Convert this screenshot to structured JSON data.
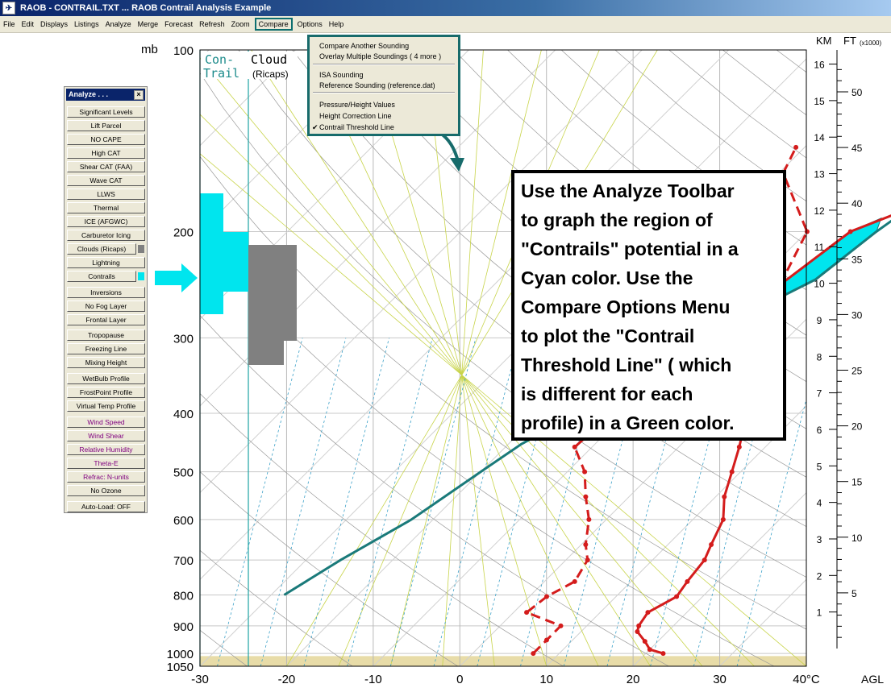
{
  "window": {
    "title": "RAOB  -  CONTRAIL.TXT  ...  RAOB Contrail Analysis Example"
  },
  "menu": [
    "File",
    "Edit",
    "Displays",
    "Listings",
    "Analyze",
    "Merge",
    "Forecast",
    "Refresh",
    "Zoom",
    "Compare",
    "Options",
    "Help"
  ],
  "menu_active": "Compare",
  "compare_menu": {
    "items": [
      "Compare Another Sounding",
      "Overlay Multiple Soundings  ( 4 more )",
      "ISA Sounding",
      "Reference Sounding (reference.dat)",
      "Pressure/Height Values",
      "Height Correction Line",
      "Contrail Threshold Line"
    ],
    "checked": "Contrail Threshold Line"
  },
  "analyze_toolbar": {
    "title": "Analyze . . .",
    "close": "×",
    "buttons": [
      "Significant Levels",
      "Lift Parcel",
      "NO CAPE",
      "High CAT",
      "Shear CAT  (FAA)",
      "Wave CAT",
      "LLWS",
      "Thermal",
      "ICE (AFGWC)",
      "Carburetor Icing",
      "Clouds (Ricaps)",
      "Lightning",
      "Contrails",
      "Inversions",
      "No Fog Layer",
      "Frontal Layer",
      "Tropopause",
      "Freezing Line",
      "Mixing Height",
      "WetBulb Profile",
      "FrostPoint Profile",
      "Virtual Temp Profile",
      "Wind Speed",
      "Wind Shear",
      "Relative Humidity",
      "Theta-E",
      "Refrac: N-units",
      "No Ozone",
      "Auto-Load: OFF"
    ],
    "purple_buttons": [
      "Wind Speed",
      "Wind Shear",
      "Relative Humidity",
      "Theta-E",
      "Refrac: N-units"
    ],
    "swatches": {
      "Clouds (Ricaps)": "#808080",
      "Contrails": "#00e5ee"
    }
  },
  "chart_labels": {
    "pressure_unit": "mb",
    "km_unit": "KM",
    "ft_unit": "FT",
    "ft_multiplier": "(x1000)",
    "agl": "AGL",
    "contrail_header": [
      "Con-",
      "Trail"
    ],
    "cloud_header": [
      "Cloud",
      "(Ricaps)"
    ]
  },
  "colors": {
    "contrail": "#00e5ee",
    "cloud": "#808080",
    "threshold_line": "#1a7a7a",
    "temperature": "#d41c1c",
    "dewpoint": "#d41c1c",
    "isotherm_grid": "#c8c8c8",
    "mixing_ratio": "#3aa0c8",
    "dry_adiabat": "#999999",
    "moist_adiabat": "#c8d44a",
    "surface_band": "#e8dca8"
  },
  "callout": {
    "lines": [
      "Use the Analyze Toolbar",
      "to graph the region of",
      "\"Contrails\" potential in a",
      "Cyan color.  Use the",
      "Compare Options Menu",
      "to plot the \"Contrail",
      "Threshold Line\" ( which",
      "is different for each",
      "profile)  in a Green color."
    ]
  },
  "chart_data": {
    "type": "line",
    "title": "",
    "xlabel": "°C",
    "ylabel": "mb",
    "x_ticks": [
      -30,
      -20,
      -10,
      0,
      10,
      20,
      30,
      40
    ],
    "x_tick_labels": [
      "-30",
      "-20",
      "-10",
      "0",
      "10",
      "20",
      "30",
      "40°C"
    ],
    "xlim": [
      -30,
      40
    ],
    "y_scale": "log",
    "ylim": [
      1050,
      100
    ],
    "y_ticks": [
      100,
      200,
      300,
      400,
      500,
      600,
      700,
      800,
      900,
      1000,
      1050
    ],
    "km_ticks": [
      1,
      2,
      3,
      4,
      5,
      6,
      7,
      8,
      9,
      10,
      11,
      12,
      13,
      14,
      15,
      16
    ],
    "ft_ticks": [
      5,
      10,
      15,
      20,
      25,
      30,
      35,
      40,
      45,
      50
    ],
    "series": [
      {
        "id": "temperature",
        "style": "solid",
        "points": [
          {
            "p": 1000,
            "t": 22
          },
          {
            "p": 985,
            "t": 20
          },
          {
            "p": 955,
            "t": 18.5
          },
          {
            "p": 920,
            "t": 16.5
          },
          {
            "p": 900,
            "t": 16
          },
          {
            "p": 855,
            "t": 15.5
          },
          {
            "p": 805,
            "t": 17
          },
          {
            "p": 760,
            "t": 16.5
          },
          {
            "p": 700,
            "t": 16
          },
          {
            "p": 660,
            "t": 15
          },
          {
            "p": 600,
            "t": 13.5
          },
          {
            "p": 550,
            "t": 11
          },
          {
            "p": 500,
            "t": 9
          },
          {
            "p": 455,
            "t": 7
          },
          {
            "p": 400,
            "t": 4
          },
          {
            "p": 350,
            "t": 0.5
          },
          {
            "p": 300,
            "t": -3
          },
          {
            "p": 270,
            "t": -6
          },
          {
            "p": 245,
            "t": -7
          },
          {
            "p": 200,
            "t": -5
          },
          {
            "p": 155,
            "t": 7
          },
          {
            "p": 100,
            "t": 15
          }
        ]
      },
      {
        "id": "dewpoint",
        "style": "dashed",
        "points": [
          {
            "p": 1000,
            "t": 7
          },
          {
            "p": 950,
            "t": 7
          },
          {
            "p": 900,
            "t": 7
          },
          {
            "p": 855,
            "t": 1.5
          },
          {
            "p": 805,
            "t": 2
          },
          {
            "p": 760,
            "t": 3.5
          },
          {
            "p": 700,
            "t": 2.5
          },
          {
            "p": 660,
            "t": 0.5
          },
          {
            "p": 600,
            "t": -2
          },
          {
            "p": 550,
            "t": -5
          },
          {
            "p": 500,
            "t": -8
          },
          {
            "p": 455,
            "t": -12
          },
          {
            "p": 400,
            "t": -11.5
          },
          {
            "p": 350,
            "t": -3.5
          },
          {
            "p": 300,
            "t": -3.5
          },
          {
            "p": 270,
            "t": -4.5
          },
          {
            "p": 245,
            "t": -7
          },
          {
            "p": 200,
            "t": -10
          },
          {
            "p": 160,
            "t": -19.5
          },
          {
            "p": 145,
            "t": -21
          }
        ]
      },
      {
        "id": "contrail_threshold",
        "style": "solid",
        "points": [
          {
            "p": 800,
            "t": -28.5
          },
          {
            "p": 700,
            "t": -26
          },
          {
            "p": 600,
            "t": -22.5
          },
          {
            "p": 500,
            "t": -20
          },
          {
            "p": 450,
            "t": -18.5
          },
          {
            "p": 400,
            "t": -15.5
          },
          {
            "p": 350,
            "t": -13.5
          },
          {
            "p": 300,
            "t": -10
          },
          {
            "p": 270,
            "t": -7
          },
          {
            "p": 240,
            "t": -3.5
          },
          {
            "p": 200,
            "t": -2
          },
          {
            "p": 150,
            "t": 1.5
          },
          {
            "p": 100,
            "t": 9.5
          }
        ]
      },
      {
        "id": "contrail_region",
        "type": "area",
        "points": [
          {
            "p": 245,
            "t": -7
          },
          {
            "p": 200,
            "t": -5
          },
          {
            "p": 190,
            "t": -3
          },
          {
            "p": 200,
            "t": -2
          },
          {
            "p": 240,
            "t": -3.5
          },
          {
            "p": 255,
            "t": -5.5
          }
        ]
      }
    ]
  }
}
